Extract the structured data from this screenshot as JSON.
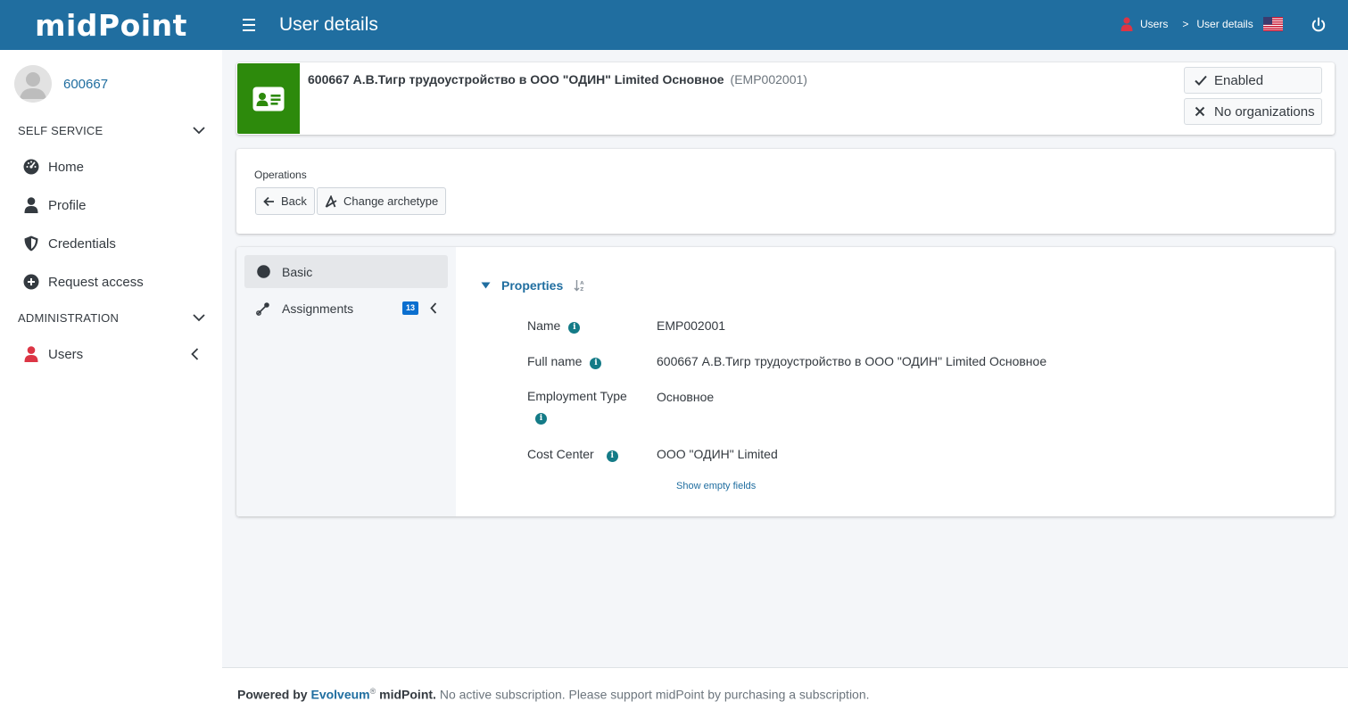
{
  "app": {
    "brand": "midPoint",
    "page_title": "User details"
  },
  "breadcrumb": {
    "items": [
      "Users",
      "User details"
    ],
    "separator": ">"
  },
  "icons": {
    "menu": "hamburger-icon",
    "language": "us-flag-icon",
    "logout": "power-icon"
  },
  "sidebar": {
    "user": "600667",
    "sections": [
      {
        "title": "SELF SERVICE",
        "items": [
          {
            "label": "Home",
            "icon": "dashboard-icon"
          },
          {
            "label": "Profile",
            "icon": "user-icon"
          },
          {
            "label": "Credentials",
            "icon": "shield-icon"
          },
          {
            "label": "Request access",
            "icon": "plus-circle-icon"
          }
        ]
      },
      {
        "title": "ADMINISTRATION",
        "items": [
          {
            "label": "Users",
            "icon": "user-red-icon"
          }
        ]
      }
    ]
  },
  "summary": {
    "title": "600667 А.В.Тигр трудоустройство в ООО \"ОДИН\" Limited Основное",
    "identifier": "(EMP002001)",
    "tags": [
      "Enabled",
      "No organizations"
    ],
    "accent_color": "#2d8a0c"
  },
  "operations": {
    "label": "Operations",
    "buttons": [
      "Back",
      "Change archetype"
    ]
  },
  "details": {
    "tabs": [
      {
        "label": "Basic",
        "active": true
      },
      {
        "label": "Assignments",
        "count": "13"
      }
    ],
    "section_title": "Properties",
    "properties": [
      {
        "label": "Name",
        "value": "EMP002001"
      },
      {
        "label": "Full name",
        "value": "600667 А.В.Тигр трудоустройство в ООО \"ОДИН\" Limited Основное"
      },
      {
        "label": "Employment Type",
        "value": "Основное"
      },
      {
        "label": "Cost Center",
        "value": "ООО \"ОДИН\" Limited"
      }
    ],
    "show_empty": "Show empty fields"
  },
  "footer": {
    "powered_by": "Powered by",
    "company": "Evolveum",
    "registered": "®",
    "product": "midPoint.",
    "notice": "No active subscription. Please support midPoint by purchasing a subscription."
  },
  "colors": {
    "header": "#206ea0",
    "link": "#206ea0",
    "info": "#147b87",
    "badge": "#0b6fcf",
    "danger": "#dc3545"
  }
}
